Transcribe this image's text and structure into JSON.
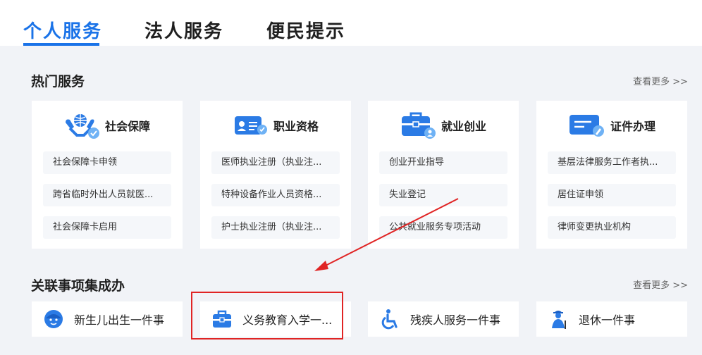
{
  "tabs": [
    {
      "label": "个人服务",
      "active": true
    },
    {
      "label": "法人服务",
      "active": false
    },
    {
      "label": "便民提示",
      "active": false
    }
  ],
  "hot": {
    "title": "热门服务",
    "more": "查看更多 >>",
    "cards": [
      {
        "name": "社会保障",
        "icon": "social-security-icon",
        "items": [
          "社会保障卡申领",
          "跨省临时外出人员就医...",
          "社会保障卡启用"
        ]
      },
      {
        "name": "职业资格",
        "icon": "id-card-icon",
        "items": [
          "医师执业注册（执业注...",
          "特种设备作业人员资格...",
          "护士执业注册（执业注..."
        ]
      },
      {
        "name": "就业创业",
        "icon": "briefcase-icon",
        "items": [
          "创业开业指导",
          "失业登记",
          "公共就业服务专项活动"
        ]
      },
      {
        "name": "证件办理",
        "icon": "certificate-icon",
        "items": [
          "基层法律服务工作者执...",
          "居住证申领",
          "律师变更执业机构"
        ]
      }
    ]
  },
  "related": {
    "title": "关联事项集成办",
    "more": "查看更多 >>",
    "items": [
      {
        "label": "新生儿出生一件事",
        "icon": "baby-icon"
      },
      {
        "label": "义务教育入学一...",
        "icon": "school-bag-icon"
      },
      {
        "label": "残疾人服务一件事",
        "icon": "wheelchair-icon"
      },
      {
        "label": "退休一件事",
        "icon": "retiree-icon"
      }
    ]
  },
  "colors": {
    "accent": "#1a73e8",
    "highlight": "#e02424",
    "background": "#f1f3f7"
  }
}
